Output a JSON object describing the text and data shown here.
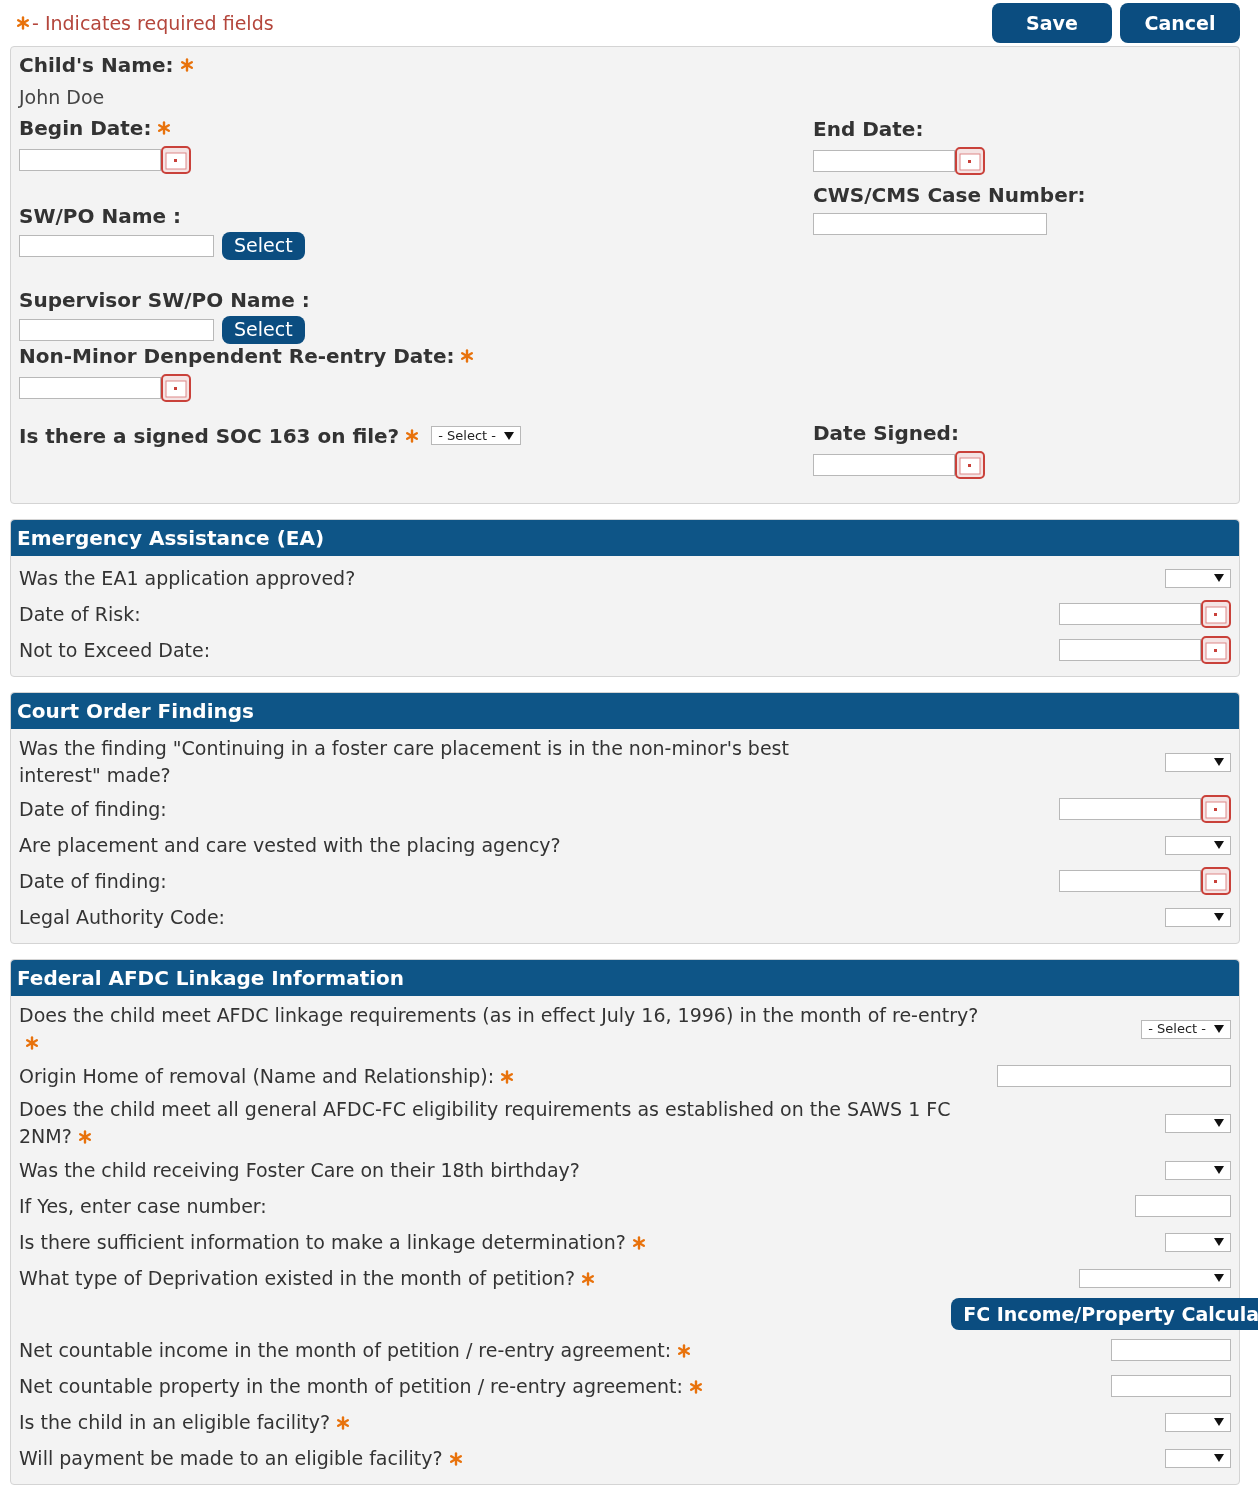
{
  "required_note": "- Indicates required fields",
  "buttons": [
    "Save",
    "Cancel"
  ],
  "main_panel": {
    "left": [
      {
        "label": "Child's Name:",
        "required": true,
        "kind": "static",
        "value": "John Doe"
      },
      {
        "label": "Begin Date:",
        "required": true,
        "kind": "date"
      },
      {
        "label": "SW/PO Name :",
        "required": false,
        "kind": "picker",
        "button": "Select"
      },
      {
        "label": "Supervisor SW/PO Name :",
        "required": false,
        "kind": "picker",
        "button": "Select"
      },
      {
        "label": "Non-Minor Denpendent Re-entry Date:",
        "required": true,
        "kind": "date"
      },
      {
        "label": "Is there a signed SOC 163 on file?",
        "required": true,
        "kind": "inline_select",
        "value": "- Select -"
      }
    ],
    "right": [
      {
        "label": "End Date:",
        "kind": "date"
      },
      {
        "label": "CWS/CMS Case Number:",
        "kind": "text"
      },
      {
        "label": "Date Signed:",
        "kind": "date"
      }
    ]
  },
  "sections": [
    {
      "title": "Emergency Assistance (EA)",
      "rows": [
        {
          "label": "Was the EA1 application approved?",
          "required": false,
          "kind": "select"
        },
        {
          "label": "Date of Risk:",
          "required": false,
          "kind": "date"
        },
        {
          "label": "Not to Exceed Date:",
          "required": false,
          "kind": "date"
        }
      ]
    },
    {
      "title": "Court Order Findings",
      "rows": [
        {
          "label": "Was the finding \"Continuing in a foster care placement is in the non-minor's best interest\" made?",
          "required": false,
          "kind": "select"
        },
        {
          "label": "Date of finding:",
          "required": false,
          "kind": "date"
        },
        {
          "label": "Are placement and care vested with the placing agency?",
          "required": false,
          "kind": "select"
        },
        {
          "label": "Date of finding:",
          "required": false,
          "kind": "date"
        },
        {
          "label": "Legal Authority Code:",
          "required": false,
          "kind": "select"
        }
      ]
    },
    {
      "title": "Federal AFDC Linkage Information",
      "rows": [
        {
          "label": "Does the child meet AFDC linkage requirements (as in effect July 16, 1996) in the month of re-entry?",
          "required": true,
          "kind": "select",
          "value": "- Select -"
        },
        {
          "label": "Origin Home of removal (Name and Relationship):",
          "required": true,
          "kind": "text"
        },
        {
          "label": "Does the child meet all general AFDC-FC eligibility requirements as established on the SAWS 1 FC 2NM?",
          "required": true,
          "kind": "select"
        },
        {
          "label": "Was the child receiving Foster Care on their 18th birthday?",
          "required": false,
          "kind": "select"
        },
        {
          "label": "If Yes, enter case number:",
          "required": false,
          "kind": "short_text"
        },
        {
          "label": "Is there sufficient information to make a linkage determination?",
          "required": true,
          "kind": "select"
        },
        {
          "label": "What type of Deprivation existed in the month of petition?",
          "required": true,
          "kind": "wide_select"
        },
        {
          "kind": "button",
          "button": "FC Income/Property Calcula"
        },
        {
          "label": "Net countable income in the month of petition / re-entry agreement:",
          "required": true,
          "kind": "medium_text"
        },
        {
          "label": "Net countable property in the month of petition / re-entry agreement:",
          "required": true,
          "kind": "medium_text"
        },
        {
          "label": "Is the child in an eligible facility?",
          "required": true,
          "kind": "select"
        },
        {
          "label": "Will payment be made to an eligible facility?",
          "required": true,
          "kind": "select"
        }
      ]
    }
  ]
}
